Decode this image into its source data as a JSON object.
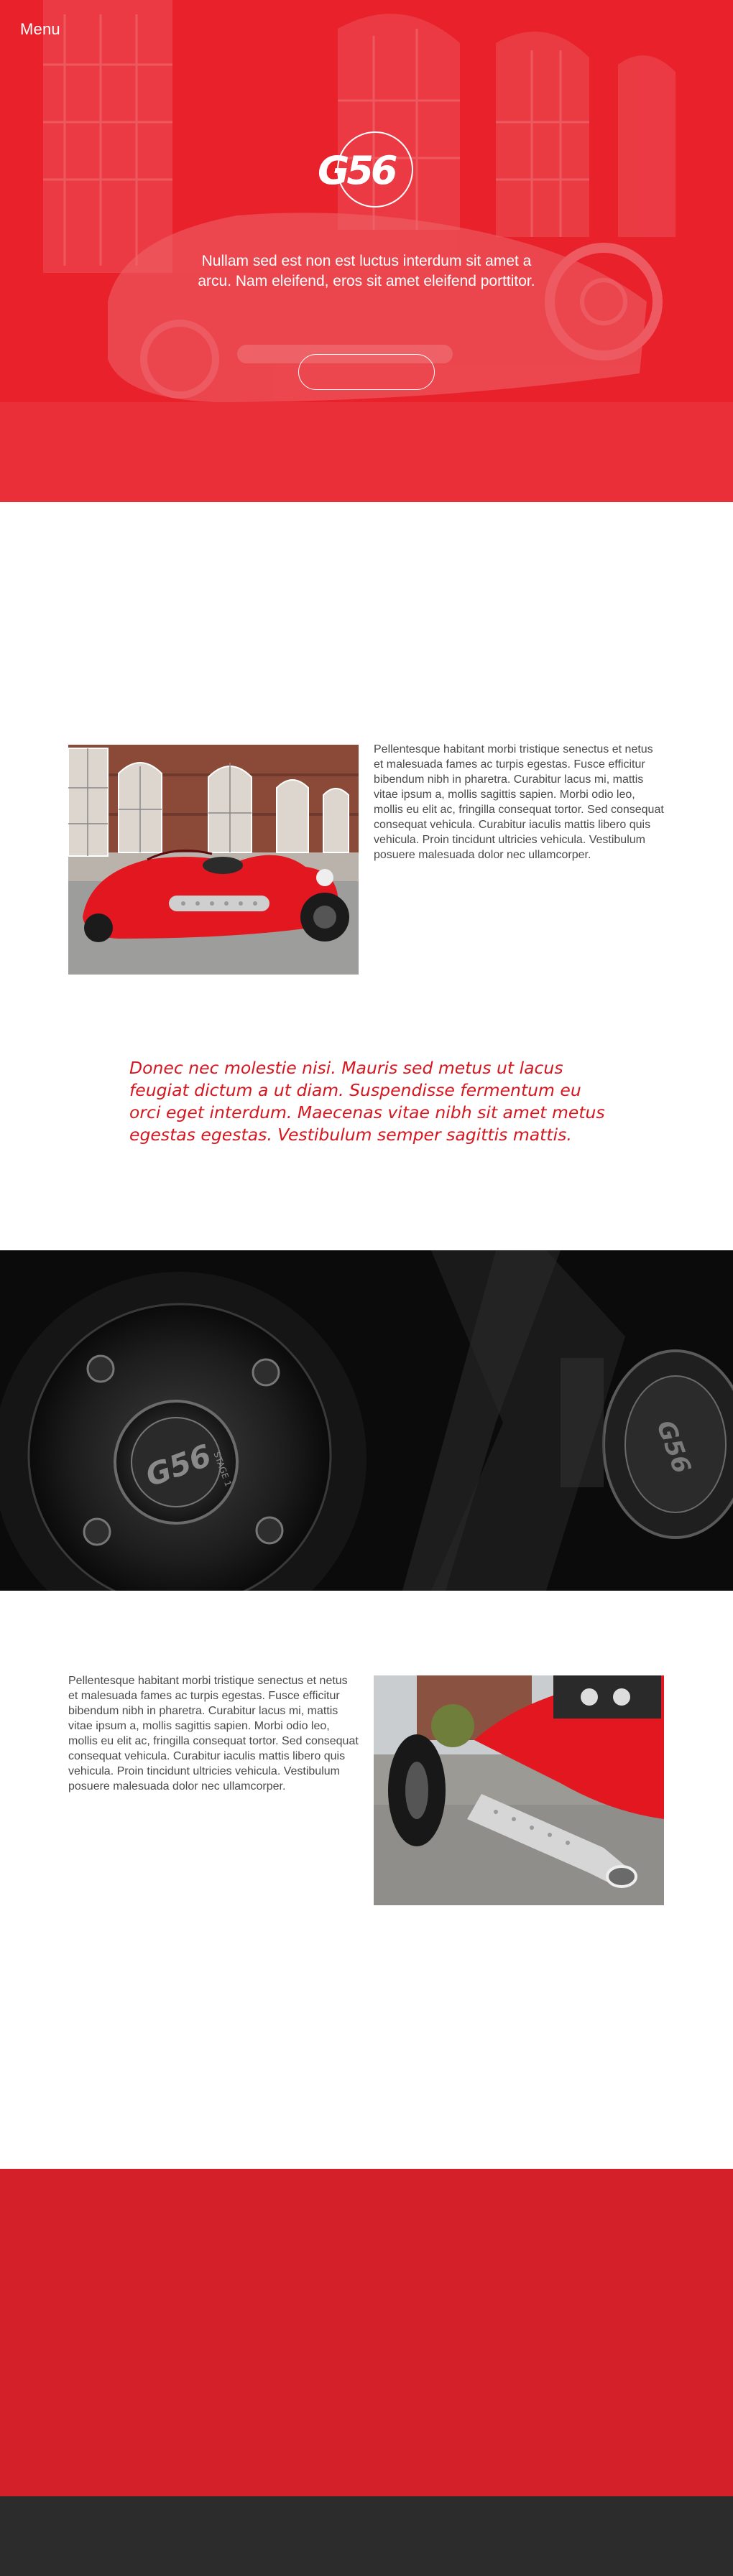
{
  "header": {
    "menu_label": "Menu",
    "logo_text": "G56"
  },
  "hero": {
    "text": "Nullam sed est non est luctus interdum sit amet a arcu. Nam eleifend, eros sit amet eleifend porttitor.",
    "button_label": ""
  },
  "section1": {
    "body": "Pellentesque habitant morbi tristique senectus et netus et malesuada fames ac turpis egestas. Fusce efficitur bibendum nibh in pharetra. Curabitur lacus mi, mattis vitae ipsum a, mollis sagittis sapien. Morbi odio leo, mollis eu elit ac, fringilla consequat tortor. Sed consequat consequat vehicula. Curabitur iaculis mattis libero quis vehicula. Proin tincidunt ultricies vehicula. Vestibulum posuere malesuada dolor nec ullamcorper."
  },
  "quote": {
    "text": "Donec nec molestie nisi. Mauris sed metus ut lacus feugiat dictum a ut diam. Suspendisse fermentum eu orci eget interdum. Maecenas vitae nibh sit amet metus egestas egestas. Vestibulum semper sagittis mattis."
  },
  "engine": {
    "badge_text": "G56",
    "stage_text": "STAGE 1"
  },
  "section2": {
    "body": "Pellentesque habitant morbi tristique senectus et netus et malesuada fames ac turpis egestas. Fusce efficitur bibendum nibh in pharetra. Curabitur lacus mi, mattis vitae ipsum a, mollis sagittis sapien. Morbi odio leo, mollis eu elit ac, fringilla consequat tortor. Sed consequat consequat vehicula. Curabitur iaculis mattis libero quis vehicula. Proin tincidunt ultricies vehicula. Vestibulum posuere malesuada dolor nec ullamcorper."
  },
  "colors": {
    "brand_red": "#e8212b",
    "quote_red": "#d7171f",
    "footer_red": "#d42129",
    "footer_dark": "#2c2c2c"
  }
}
